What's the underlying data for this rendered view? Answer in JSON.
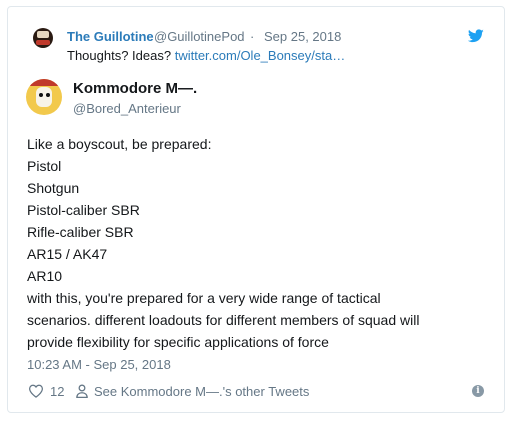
{
  "quoted_tweet": {
    "name": "The Guillotine",
    "handle": "@GuillotinePod",
    "separator": "·",
    "date": "Sep 25, 2018",
    "text_prefix": "Thoughts? Ideas? ",
    "link": "twitter.com/Ole_Bonsey/sta…"
  },
  "tweet": {
    "name": "Kommodore M—.",
    "handle": "@Bored_Anterieur",
    "lines": [
      "Like a boyscout, be prepared:",
      "Pistol",
      "Shotgun",
      "Pistol-caliber SBR",
      "Rifle-caliber SBR",
      "AR15 / AK47",
      "AR10",
      "with this, you're prepared for a very wide range of tactical",
      "scenarios. different loadouts for different members of squad will",
      "provide flexibility for specific applications of force"
    ],
    "timestamp": "10:23 AM - Sep 25, 2018"
  },
  "actions": {
    "like_count": "12",
    "see_tweets": "See Kommodore M—.'s other Tweets",
    "info_glyph": "i"
  },
  "colors": {
    "link": "#2b7bb9",
    "muted": "#657786",
    "text": "#14171a",
    "twitter_blue": "#1da1f2"
  },
  "icons": [
    "twitter-bird-icon",
    "heart-icon",
    "person-icon",
    "info-icon"
  ]
}
